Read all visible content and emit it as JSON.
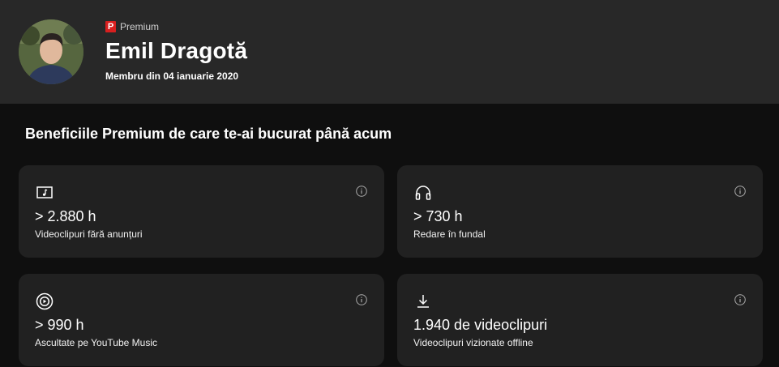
{
  "profile": {
    "badge_letter": "P",
    "badge_text": "Premium",
    "name": "Emil Dragotă",
    "member_since": "Membru din 04 ianuarie 2020"
  },
  "section_title": "Beneficiile Premium de care te-ai bucurat până acum",
  "cards": [
    {
      "icon": "music-video-icon",
      "value": "> 2.880 h",
      "label": "Videoclipuri fără anunțuri"
    },
    {
      "icon": "headphones-icon",
      "value": "> 730 h",
      "label": "Redare în fundal"
    },
    {
      "icon": "youtube-music-icon",
      "value": "> 990 h",
      "label": "Ascultate pe YouTube Music"
    },
    {
      "icon": "download-icon",
      "value": "1.940 de videoclipuri",
      "label": "Videoclipuri vizionate offline"
    }
  ],
  "colors": {
    "background": "#0f0f0f",
    "header": "#282828",
    "card": "#212121",
    "badge": "#d81f1f"
  }
}
